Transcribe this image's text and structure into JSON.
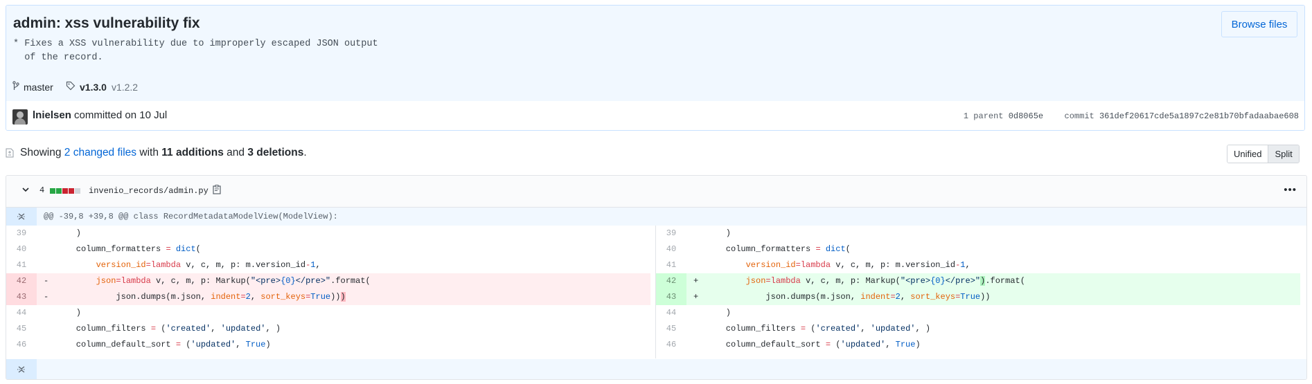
{
  "commit": {
    "title": "admin: xss vulnerability fix",
    "description": "* Fixes a XSS vulnerability due to improperly escaped JSON output\n  of the record.",
    "browse_files_label": "Browse files",
    "branch": "master",
    "tag_primary": "v1.3.0",
    "tag_secondary": "v1.2.2",
    "author": "lnielsen",
    "committed_text": "committed on 10 Jul",
    "parent_label": "1 parent",
    "parent_sha": "0d8065e",
    "commit_label": "commit",
    "commit_sha": "361def20617cde5a1897c2e81b70bfadaabae608"
  },
  "toc": {
    "prefix": "Showing",
    "changed_files": "2 changed files",
    "with": "with",
    "additions": "11 additions",
    "and": "and",
    "deletions": "3 deletions",
    "suffix": "."
  },
  "view_toggle": {
    "unified": "Unified",
    "split": "Split",
    "selected": "Split"
  },
  "file": {
    "change_count": "4",
    "diffstat": [
      "#28a745",
      "#28a745",
      "#cb2431",
      "#cb2431",
      "#d1d5da"
    ],
    "path": "invenio_records/admin.py",
    "hunk_header": "@@ -39,8 +39,8 @@ class RecordMetadataModelView(ModelView):"
  },
  "diff": {
    "left_numbers": [
      "39",
      "40",
      "41",
      "42",
      "43",
      "44",
      "45",
      "46"
    ],
    "right_numbers": [
      "39",
      "40",
      "41",
      "42",
      "43",
      "44",
      "45",
      "46"
    ],
    "del_marker": "-",
    "add_marker": "+"
  },
  "colors": {
    "link": "#0366d6",
    "addition": "#28a745",
    "deletion": "#cb2431",
    "header_bg": "#f1f8ff"
  }
}
